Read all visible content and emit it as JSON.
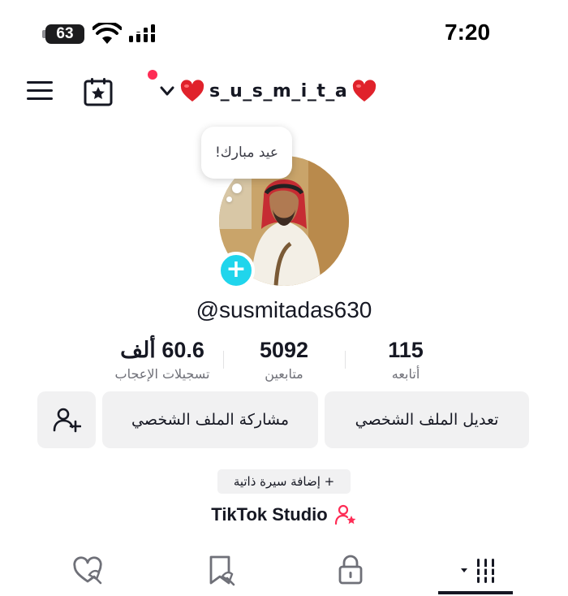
{
  "status_bar": {
    "battery": "63",
    "time": "7:20"
  },
  "header": {
    "username": "s_u_s_m_i_t_a",
    "icons": [
      "menu-icon",
      "calendar-star-icon",
      "chevron-down-icon",
      "heart-icon"
    ],
    "accent_color": "#fe2c55"
  },
  "profile": {
    "note": "عيد مبارك!",
    "handle": "@susmitadas630",
    "add_color": "#20d5ec"
  },
  "stats": [
    {
      "value": "60.6 ألف",
      "label": "تسجيلات الإعجاب"
    },
    {
      "value": "5092",
      "label": "متابعين"
    },
    {
      "value": "115",
      "label": "أتابعه"
    }
  ],
  "actions": {
    "edit_profile": "تعديل الملف الشخصي",
    "share_profile": "مشاركة الملف الشخصي",
    "add_friend_icon": "add-friend-icon"
  },
  "bio_button": "+ إضافة سيرة ذاتية",
  "studio": {
    "label": "TikTok Studio",
    "icon": "creator-star-icon"
  },
  "tabs": [
    {
      "icon": "liked-heart-icon",
      "selected": false
    },
    {
      "icon": "favorites-bookmark-icon",
      "selected": false
    },
    {
      "icon": "private-lock-icon",
      "selected": false
    },
    {
      "icon": "videos-grid-icon",
      "selected": true
    }
  ]
}
